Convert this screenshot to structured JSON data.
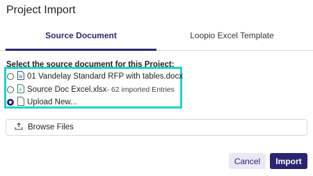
{
  "dialog": {
    "title": "Project Import"
  },
  "tabs": [
    {
      "label": "Source Document",
      "active": true
    },
    {
      "label": "Loopio Excel Template",
      "active": false
    }
  ],
  "source": {
    "prompt": "Select the source document for this Project:",
    "options": [
      {
        "name": "01 Vandelay Standard RFP with tables.docx",
        "meta": "",
        "icon": "word-file-icon",
        "selected": false
      },
      {
        "name": "Source Doc Excel.xlsx",
        "meta": " - 62 imported Entries",
        "icon": "excel-file-icon",
        "selected": false
      },
      {
        "name": "Upload New...",
        "meta": "",
        "icon": "blank-file-icon",
        "selected": true
      }
    ]
  },
  "browse": {
    "label": "Browse Files",
    "icon": "upload-icon"
  },
  "actions": {
    "cancel": "Cancel",
    "import": "Import"
  },
  "colors": {
    "accent": "#2a2570",
    "highlight": "#1fd1c7",
    "excel": "#2e8b57",
    "word": "#2b579a"
  }
}
